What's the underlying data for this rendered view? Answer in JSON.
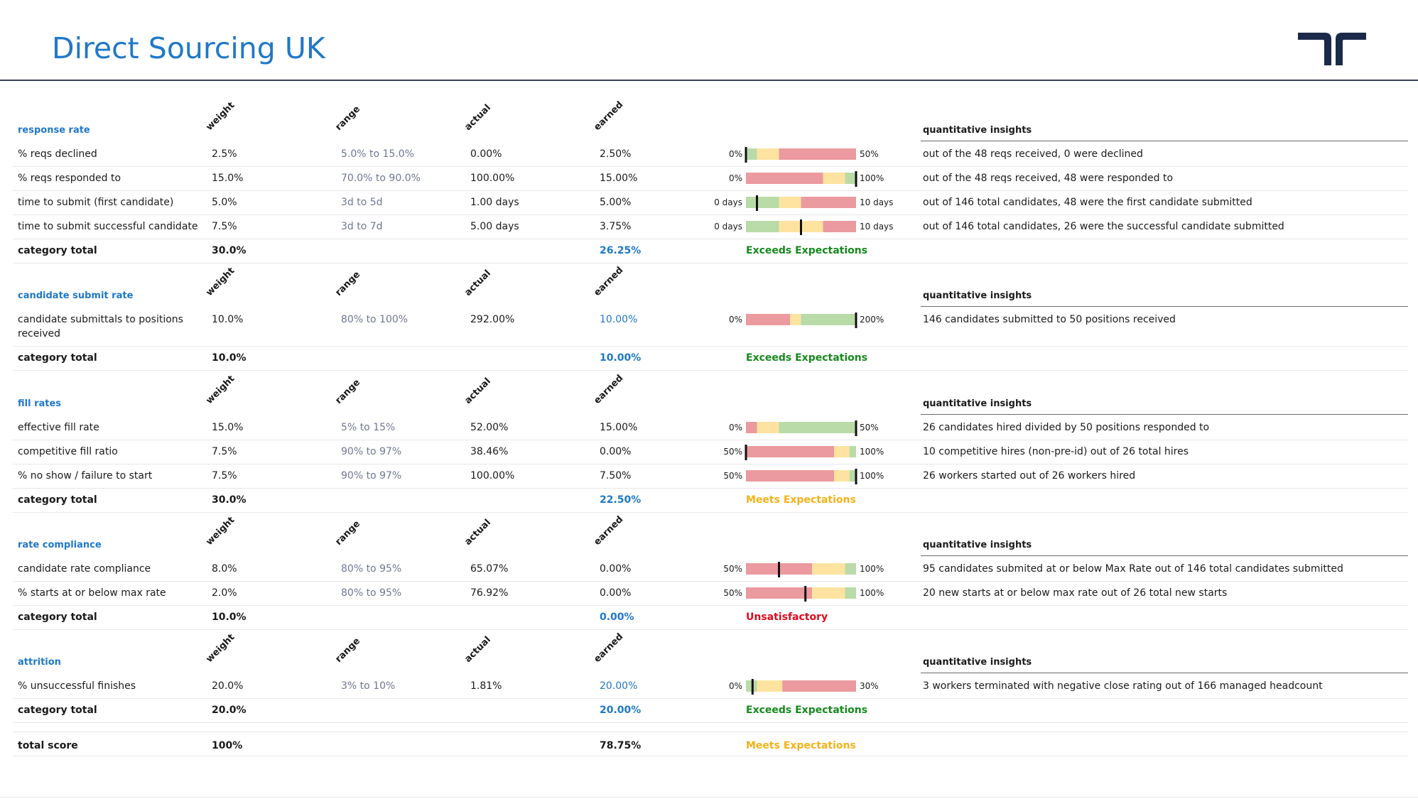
{
  "page": {
    "title": "Direct Sourcing UK",
    "logo_icon": "randstad-logo-icon",
    "brand_color": "#1f78c8",
    "logo_color": "#1b2a4a"
  },
  "column_headers": {
    "weight": "weight",
    "range": "range",
    "actual": "actual",
    "earned": "earned",
    "insights": "quantitative insights"
  },
  "bar_colors": {
    "red": "#eb9a9f",
    "yellow": "#fde39f",
    "green": "#b9dba8",
    "marker": "#111111"
  },
  "status_colors": {
    "Exceeds Expectations": "#158a1c",
    "Meets Expectations": "#f3b21a",
    "Unsatisfactory": "#e00b1c"
  },
  "categories": [
    {
      "name": "response rate",
      "rows": [
        {
          "metric": "% reqs declined",
          "weight": "2.5%",
          "range": "5.0% to 15.0%",
          "actual": "0.00%",
          "earned": "2.50%",
          "earned_highlight": false,
          "bar": {
            "min_label": "0%",
            "max_label": "50%",
            "segments": [
              [
                "green",
                0,
                0.1
              ],
              [
                "yellow",
                0.1,
                0.3
              ],
              [
                "red",
                0.3,
                1
              ]
            ],
            "marker": 0
          },
          "insight": "out of the 48 reqs received, 0 were declined"
        },
        {
          "metric": "% reqs responded to",
          "weight": "15.0%",
          "range": "70.0% to 90.0%",
          "actual": "100.00%",
          "earned": "15.00%",
          "earned_highlight": false,
          "bar": {
            "min_label": "0%",
            "max_label": "100%",
            "segments": [
              [
                "red",
                0,
                0.7
              ],
              [
                "yellow",
                0.7,
                0.9
              ],
              [
                "green",
                0.9,
                1
              ]
            ],
            "marker": 1
          },
          "insight": "out of the 48 reqs received, 48 were responded to"
        },
        {
          "metric": "time to submit (first candidate)",
          "weight": "5.0%",
          "range": "3d to 5d",
          "actual": "1.00 days",
          "earned": "5.00%",
          "earned_highlight": false,
          "bar": {
            "min_label": "0 days",
            "max_label": "10 days",
            "segments": [
              [
                "green",
                0,
                0.3
              ],
              [
                "yellow",
                0.3,
                0.5
              ],
              [
                "red",
                0.5,
                1
              ]
            ],
            "marker": 0.1
          },
          "insight": "out of 146 total candidates, 48 were the first candidate submitted"
        },
        {
          "metric": "time to submit successful candidate",
          "weight": "7.5%",
          "range": "3d to 7d",
          "actual": "5.00 days",
          "earned": "3.75%",
          "earned_highlight": false,
          "bar": {
            "min_label": "0 days",
            "max_label": "10 days",
            "segments": [
              [
                "green",
                0,
                0.3
              ],
              [
                "yellow",
                0.3,
                0.7
              ],
              [
                "red",
                0.7,
                1
              ]
            ],
            "marker": 0.5
          },
          "insight": "out of 146 total candidates, 26 were the successful candidate submitted"
        }
      ],
      "total": {
        "label": "category total",
        "weight": "30.0%",
        "earned": "26.25%",
        "status": "Exceeds Expectations"
      }
    },
    {
      "name": "candidate submit rate",
      "rows": [
        {
          "metric": "candidate submittals to positions",
          "metric_line2": "received",
          "weight": "10.0%",
          "range": "80% to 100%",
          "actual": "292.00%",
          "earned": "10.00%",
          "earned_highlight": true,
          "bar": {
            "min_label": "0%",
            "max_label": "200%",
            "segments": [
              [
                "red",
                0,
                0.4
              ],
              [
                "yellow",
                0.4,
                0.5
              ],
              [
                "green",
                0.5,
                1
              ]
            ],
            "marker": 1
          },
          "insight": "146 candidates submitted to 50 positions received"
        }
      ],
      "total": {
        "label": "category total",
        "weight": "10.0%",
        "earned": "10.00%",
        "status": "Exceeds Expectations"
      }
    },
    {
      "name": "fill rates",
      "rows": [
        {
          "metric": "effective fill rate",
          "weight": "15.0%",
          "range": "5% to 15%",
          "actual": "52.00%",
          "earned": "15.00%",
          "earned_highlight": false,
          "bar": {
            "min_label": "0%",
            "max_label": "50%",
            "segments": [
              [
                "red",
                0,
                0.1
              ],
              [
                "yellow",
                0.1,
                0.3
              ],
              [
                "green",
                0.3,
                1
              ]
            ],
            "marker": 1
          },
          "insight": "26 candidates hired divided by 50 positions responded to"
        },
        {
          "metric": "competitive fill ratio",
          "weight": "7.5%",
          "range": "90% to 97%",
          "actual": "38.46%",
          "earned": "0.00%",
          "earned_highlight": false,
          "bar": {
            "min_label": "50%",
            "max_label": "100%",
            "segments": [
              [
                "red",
                0,
                0.8
              ],
              [
                "yellow",
                0.8,
                0.94
              ],
              [
                "green",
                0.94,
                1
              ]
            ],
            "marker": 0
          },
          "insight": "10 competitive hires (non-pre-id) out of 26 total hires"
        },
        {
          "metric": "% no show / failure to start",
          "weight": "7.5%",
          "range": "90% to 97%",
          "actual": "100.00%",
          "earned": "7.50%",
          "earned_highlight": false,
          "bar": {
            "min_label": "50%",
            "max_label": "100%",
            "segments": [
              [
                "red",
                0,
                0.8
              ],
              [
                "yellow",
                0.8,
                0.94
              ],
              [
                "green",
                0.94,
                1
              ]
            ],
            "marker": 1
          },
          "insight": "26 workers started out of 26 workers hired"
        }
      ],
      "total": {
        "label": "category total",
        "weight": "30.0%",
        "earned": "22.50%",
        "status": "Meets Expectations"
      }
    },
    {
      "name": "rate compliance",
      "rows": [
        {
          "metric": "candidate rate compliance",
          "weight": "8.0%",
          "range": "80% to 95%",
          "actual": "65.07%",
          "earned": "0.00%",
          "earned_highlight": false,
          "bar": {
            "min_label": "50%",
            "max_label": "100%",
            "segments": [
              [
                "red",
                0,
                0.6
              ],
              [
                "yellow",
                0.6,
                0.9
              ],
              [
                "green",
                0.9,
                1
              ]
            ],
            "marker": 0.3
          },
          "insight": "95 candidates submited at or below Max Rate out of 146 total candidates submitted"
        },
        {
          "metric": "% starts at or below max rate",
          "weight": "2.0%",
          "range": "80% to 95%",
          "actual": "76.92%",
          "earned": "0.00%",
          "earned_highlight": false,
          "bar": {
            "min_label": "50%",
            "max_label": "100%",
            "segments": [
              [
                "red",
                0,
                0.6
              ],
              [
                "yellow",
                0.6,
                0.9
              ],
              [
                "green",
                0.9,
                1
              ]
            ],
            "marker": 0.54
          },
          "insight": "20 new starts at or below max rate out of 26 total new starts"
        }
      ],
      "total": {
        "label": "category total",
        "weight": "10.0%",
        "earned": "0.00%",
        "status": "Unsatisfactory"
      }
    },
    {
      "name": "attrition",
      "rows": [
        {
          "metric": "% unsuccessful finishes",
          "weight": "20.0%",
          "range": "3% to 10%",
          "actual": "1.81%",
          "earned": "20.00%",
          "earned_highlight": true,
          "bar": {
            "min_label": "0%",
            "max_label": "30%",
            "segments": [
              [
                "green",
                0,
                0.1
              ],
              [
                "yellow",
                0.1,
                0.33
              ],
              [
                "red",
                0.33,
                1
              ]
            ],
            "marker": 0.06
          },
          "insight": "3 workers terminated with negative close rating out of 166 managed headcount"
        }
      ],
      "total": {
        "label": "category total",
        "weight": "20.0%",
        "earned": "20.00%",
        "status": "Exceeds Expectations"
      }
    }
  ],
  "grand_total": {
    "label": "total score",
    "weight": "100%",
    "earned": "78.75%",
    "status": "Meets Expectations"
  }
}
